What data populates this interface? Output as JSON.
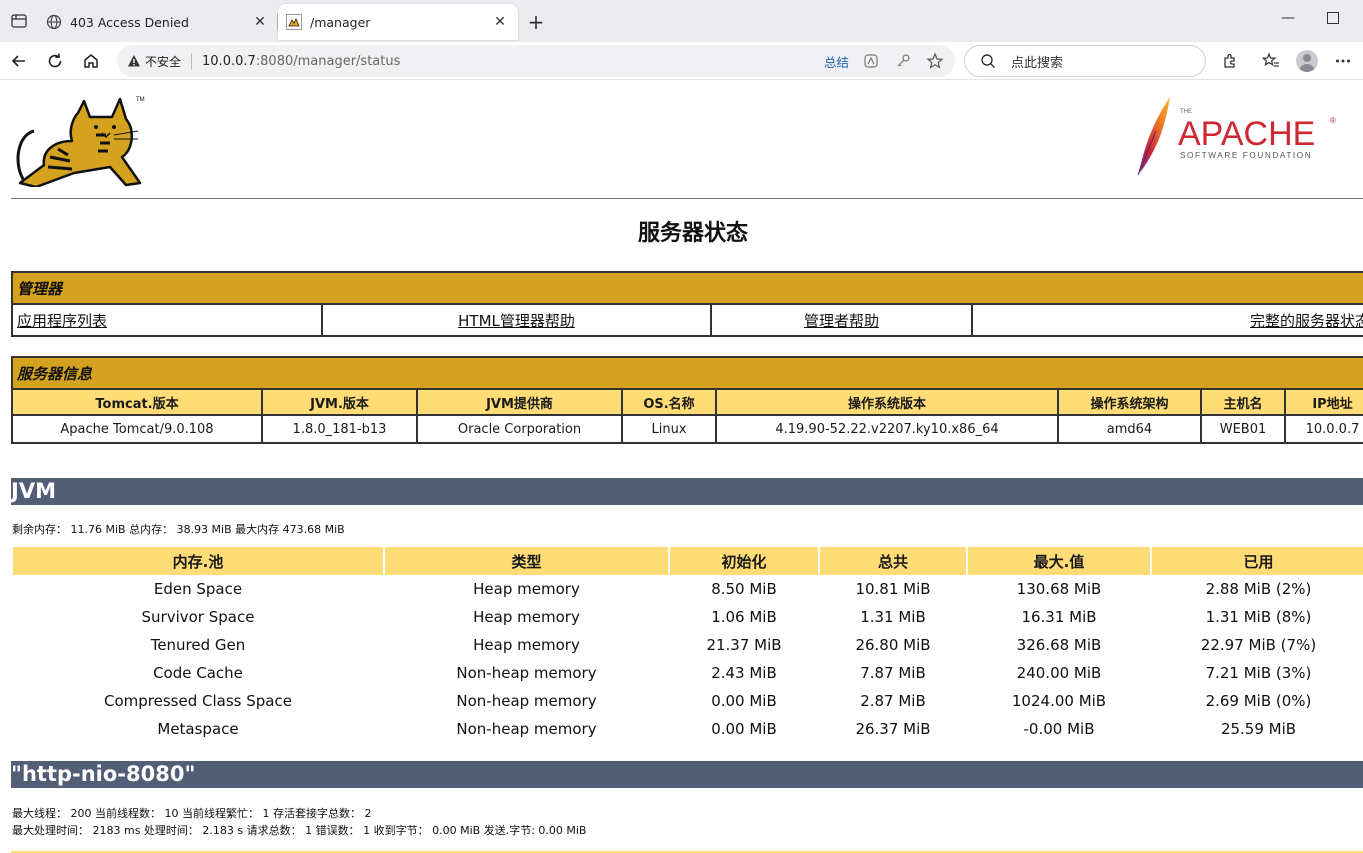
{
  "browser": {
    "tabs": [
      {
        "title": "403 Access Denied",
        "active": false
      },
      {
        "title": "/manager",
        "active": true
      }
    ],
    "address": {
      "security_label": "不安全",
      "url_host": "10.0.0.7",
      "url_rest": ":8080/manager/status",
      "summary_label": "总结"
    },
    "search_placeholder": "点此搜索"
  },
  "page": {
    "title": "服务器状态",
    "manager": {
      "heading": "管理器",
      "links": [
        "应用程序列表",
        "HTML管理器帮助",
        "管理者帮助",
        "完整的服务器状态"
      ]
    },
    "server_info": {
      "heading": "服务器信息",
      "columns": [
        "Tomcat.版本",
        "JVM.版本",
        "JVM提供商",
        "OS.名称",
        "操作系统版本",
        "操作系统架构",
        "主机名",
        "IP地址"
      ],
      "values": [
        "Apache Tomcat/9.0.108",
        "1.8.0_181-b13",
        "Oracle Corporation",
        "Linux",
        "4.19.90-52.22.v2207.ky10.x86_64",
        "amd64",
        "WEB01",
        "10.0.0.7"
      ]
    },
    "jvm": {
      "heading": "JVM",
      "summary": "剩余内存： 11.76 MiB 总内存： 38.93 MiB 最大内存 473.68 MiB",
      "columns": [
        "内存.池",
        "类型",
        "初始化",
        "总共",
        "最大.值",
        "已用"
      ],
      "rows": [
        [
          "Eden Space",
          "Heap memory",
          "8.50 MiB",
          "10.81 MiB",
          "130.68 MiB",
          "2.88 MiB (2%)"
        ],
        [
          "Survivor Space",
          "Heap memory",
          "1.06 MiB",
          "1.31 MiB",
          "16.31 MiB",
          "1.31 MiB (8%)"
        ],
        [
          "Tenured Gen",
          "Heap memory",
          "21.37 MiB",
          "26.80 MiB",
          "326.68 MiB",
          "22.97 MiB (7%)"
        ],
        [
          "Code Cache",
          "Non-heap memory",
          "2.43 MiB",
          "7.87 MiB",
          "240.00 MiB",
          "7.21 MiB (3%)"
        ],
        [
          "Compressed Class Space",
          "Non-heap memory",
          "0.00 MiB",
          "2.87 MiB",
          "1024.00 MiB",
          "2.69 MiB (0%)"
        ],
        [
          "Metaspace",
          "Non-heap memory",
          "0.00 MiB",
          "26.37 MiB",
          "-0.00 MiB",
          "25.59 MiB"
        ]
      ]
    },
    "connector": {
      "heading": "\"http-nio-8080\"",
      "line1": "最大线程： 200 当前线程数： 10 当前线程繁忙： 1 存活套接字总数： 2",
      "line2": "最大处理时间： 2183 ms 处理时间： 2.183 s 请求总数： 1 错误数： 1 收到字节： 0.00 MiB 发送.字节: 0.00 MiB"
    },
    "apache_logo": {
      "the": "THE",
      "name": "APACHE",
      "tm": "®",
      "sub": "SOFTWARE FOUNDATION"
    },
    "tomcat_logo": {
      "tm": "TM"
    }
  },
  "colors": {
    "section_gold": "#d4a21f",
    "header_yellow": "#ffdc75",
    "band_slate": "#525d76",
    "apache_red": "#cf2833"
  }
}
